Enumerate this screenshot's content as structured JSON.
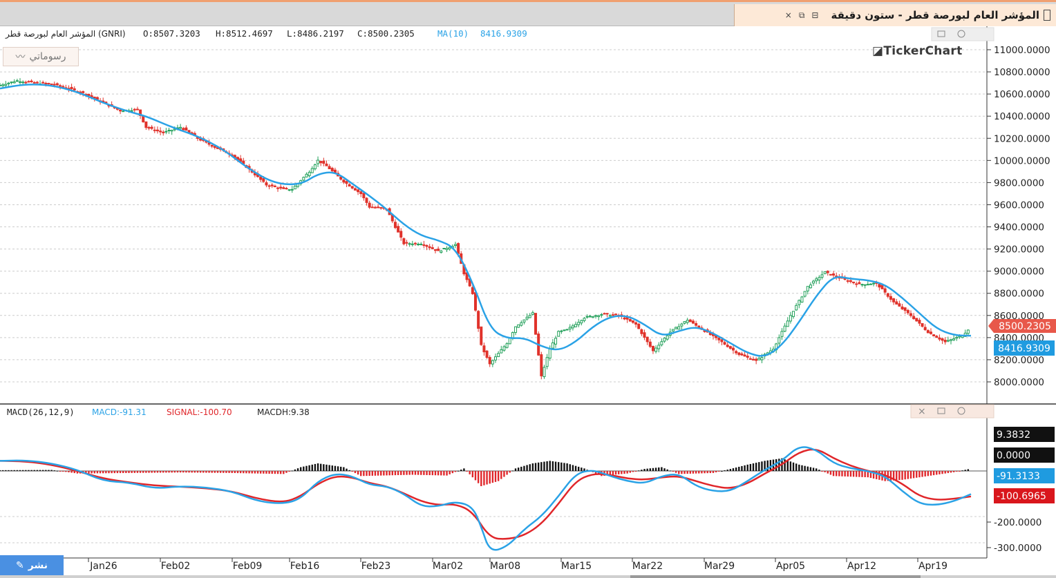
{
  "window": {
    "title": "المؤشر العام لبورصة قطر - ستون دقيقة",
    "controls": [
      "×",
      "⧉",
      "⊟"
    ]
  },
  "toolbar": {
    "drawings_label": "رسوماتي",
    "publish_label": "نشر",
    "brand": "TickerChart"
  },
  "price_panel": {
    "symbol_label": "المؤشر العام لبورصة قطر (GNRI)",
    "ohlc": {
      "open": "O:8507.3203",
      "high": "H:8512.4697",
      "low": "L:8486.2197",
      "close": "C:8500.2305"
    },
    "ma_label": "MA(10)",
    "ma_value": "8416.9309",
    "last_price_badge": "8500.2305",
    "ma_badge": "8416.9309",
    "y_ticks": [
      "11000.0000",
      "10800.0000",
      "10600.0000",
      "10400.0000",
      "10200.0000",
      "10000.0000",
      "9800.0000",
      "9600.0000",
      "9400.0000",
      "9200.0000",
      "9000.0000",
      "8800.0000",
      "8600.0000",
      "8400.0000",
      "8200.0000",
      "8000.0000"
    ]
  },
  "macd_panel": {
    "label": "MACD(26,12,9)",
    "macd": "MACD:-91.31",
    "signal": "SIGNAL:-100.70",
    "hist": "MACDH:9.38",
    "badges": {
      "hist": "9.3832",
      "zero": "0.0000",
      "macd": "-91.3133",
      "signal": "-100.6965"
    },
    "y_ticks": [
      "-200.0000",
      "-300.0000"
    ]
  },
  "x_axis": {
    "labels": [
      "Jan26",
      "Feb02",
      "Feb09",
      "Feb16",
      "Feb23",
      "Mar02",
      "Mar08",
      "Mar15",
      "Mar22",
      "Mar29",
      "Apr05",
      "Apr12",
      "Apr19"
    ]
  },
  "colors": {
    "up": "#22a05a",
    "down": "#e0322b",
    "ma": "#2aa2e6",
    "macd": "#2aa2e6",
    "signal": "#e0262a",
    "hist_pos": "#111111",
    "hist_neg": "#e0262a"
  },
  "chart_data": [
    {
      "type": "line",
      "x_index_range": [
        0,
        100
      ],
      "ylim": [
        7950,
        11050
      ],
      "series": [
        {
          "name": "المؤشر العام لبورصة قطر (GNRI)",
          "kind": "candlestick",
          "approx_close_path": [
            [
              0,
              10680
            ],
            [
              2,
              10720
            ],
            [
              4,
              10700
            ],
            [
              6,
              10690
            ],
            [
              8,
              10650
            ],
            [
              10,
              10600
            ],
            [
              12,
              10520
            ],
            [
              14,
              10450
            ],
            [
              16,
              10460
            ],
            [
              17,
              10300
            ],
            [
              19,
              10250
            ],
            [
              21,
              10300
            ],
            [
              23,
              10200
            ],
            [
              25,
              10120
            ],
            [
              27,
              10050
            ],
            [
              29,
              9920
            ],
            [
              31,
              9780
            ],
            [
              33,
              9740
            ],
            [
              34,
              9740
            ],
            [
              36,
              9900
            ],
            [
              37,
              10000
            ],
            [
              38,
              9950
            ],
            [
              40,
              9810
            ],
            [
              42,
              9700
            ],
            [
              43,
              9580
            ],
            [
              45,
              9560
            ],
            [
              46,
              9400
            ],
            [
              47,
              9250
            ],
            [
              49,
              9250
            ],
            [
              51,
              9180
            ],
            [
              53,
              9240
            ],
            [
              54,
              8980
            ],
            [
              55,
              8800
            ],
            [
              56,
              8330
            ],
            [
              57,
              8160
            ],
            [
              59,
              8350
            ],
            [
              60,
              8500
            ],
            [
              62,
              8620
            ],
            [
              63,
              8050
            ],
            [
              64,
              8300
            ],
            [
              65,
              8450
            ],
            [
              66,
              8470
            ],
            [
              68,
              8580
            ],
            [
              70,
              8610
            ],
            [
              72,
              8600
            ],
            [
              74,
              8520
            ],
            [
              76,
              8280
            ],
            [
              78,
              8450
            ],
            [
              80,
              8560
            ],
            [
              82,
              8460
            ],
            [
              84,
              8360
            ],
            [
              86,
              8250
            ],
            [
              88,
              8190
            ],
            [
              90,
              8300
            ],
            [
              92,
              8600
            ],
            [
              94,
              8860
            ],
            [
              96,
              8990
            ],
            [
              98,
              8930
            ],
            [
              100,
              8880
            ],
            [
              102,
              8890
            ],
            [
              104,
              8720
            ],
            [
              106,
              8600
            ],
            [
              108,
              8450
            ],
            [
              110,
              8360
            ],
            [
              112,
              8420
            ],
            [
              113,
              8500
            ]
          ]
        },
        {
          "name": "MA(10)",
          "values": [
            [
              0,
              10650
            ],
            [
              3,
              10690
            ],
            [
              6,
              10680
            ],
            [
              9,
              10620
            ],
            [
              12,
              10520
            ],
            [
              15,
              10440
            ],
            [
              17,
              10400
            ],
            [
              20,
              10300
            ],
            [
              23,
              10220
            ],
            [
              26,
              10100
            ],
            [
              29,
              9920
            ],
            [
              32,
              9790
            ],
            [
              35,
              9780
            ],
            [
              37,
              9880
            ],
            [
              39,
              9900
            ],
            [
              41,
              9790
            ],
            [
              43,
              9680
            ],
            [
              45,
              9560
            ],
            [
              47,
              9420
            ],
            [
              49,
              9320
            ],
            [
              51,
              9280
            ],
            [
              53,
              9210
            ],
            [
              55,
              8900
            ],
            [
              57,
              8480
            ],
            [
              59,
              8390
            ],
            [
              61,
              8400
            ],
            [
              63,
              8320
            ],
            [
              65,
              8280
            ],
            [
              67,
              8360
            ],
            [
              69,
              8500
            ],
            [
              71,
              8590
            ],
            [
              73,
              8600
            ],
            [
              75,
              8520
            ],
            [
              77,
              8410
            ],
            [
              79,
              8460
            ],
            [
              81,
              8500
            ],
            [
              83,
              8440
            ],
            [
              85,
              8350
            ],
            [
              87,
              8260
            ],
            [
              89,
              8220
            ],
            [
              91,
              8330
            ],
            [
              93,
              8540
            ],
            [
              95,
              8780
            ],
            [
              97,
              8960
            ],
            [
              99,
              8930
            ],
            [
              101,
              8920
            ],
            [
              103,
              8880
            ],
            [
              105,
              8760
            ],
            [
              107,
              8620
            ],
            [
              109,
              8480
            ],
            [
              111,
              8420
            ],
            [
              113,
              8416.93
            ]
          ]
        }
      ]
    },
    {
      "type": "line",
      "ylim": [
        -330,
        110
      ],
      "series": [
        {
          "name": "MACD",
          "values": [
            [
              0,
              40
            ],
            [
              3,
              42
            ],
            [
              6,
              30
            ],
            [
              9,
              5
            ],
            [
              12,
              -40
            ],
            [
              15,
              -45
            ],
            [
              18,
              -70
            ],
            [
              21,
              -60
            ],
            [
              24,
              -65
            ],
            [
              27,
              -80
            ],
            [
              30,
              -120
            ],
            [
              33,
              -130
            ],
            [
              35,
              -110
            ],
            [
              37,
              -40
            ],
            [
              39,
              -10
            ],
            [
              41,
              -20
            ],
            [
              43,
              -55
            ],
            [
              45,
              -60
            ],
            [
              47,
              -90
            ],
            [
              49,
              -140
            ],
            [
              51,
              -140
            ],
            [
              53,
              -120
            ],
            [
              55,
              -140
            ],
            [
              56,
              -220
            ],
            [
              57,
              -320
            ],
            [
              59,
              -300
            ],
            [
              61,
              -230
            ],
            [
              63,
              -180
            ],
            [
              65,
              -100
            ],
            [
              67,
              -10
            ],
            [
              69,
              5
            ],
            [
              71,
              -20
            ],
            [
              73,
              -40
            ],
            [
              75,
              -50
            ],
            [
              77,
              -20
            ],
            [
              79,
              -10
            ],
            [
              81,
              -60
            ],
            [
              83,
              -80
            ],
            [
              85,
              -80
            ],
            [
              87,
              -40
            ],
            [
              89,
              5
            ],
            [
              91,
              40
            ],
            [
              93,
              100
            ],
            [
              95,
              85
            ],
            [
              97,
              30
            ],
            [
              99,
              10
            ],
            [
              101,
              0
            ],
            [
              103,
              -20
            ],
            [
              105,
              -80
            ],
            [
              107,
              -130
            ],
            [
              109,
              -135
            ],
            [
              111,
              -120
            ],
            [
              113,
              -91.31
            ]
          ]
        },
        {
          "name": "SIGNAL",
          "values": [
            [
              0,
              40
            ],
            [
              3,
              38
            ],
            [
              6,
              25
            ],
            [
              9,
              0
            ],
            [
              12,
              -30
            ],
            [
              15,
              -45
            ],
            [
              18,
              -58
            ],
            [
              21,
              -62
            ],
            [
              24,
              -68
            ],
            [
              27,
              -80
            ],
            [
              30,
              -110
            ],
            [
              33,
              -125
            ],
            [
              35,
              -100
            ],
            [
              37,
              -50
            ],
            [
              39,
              -20
            ],
            [
              41,
              -25
            ],
            [
              43,
              -48
            ],
            [
              45,
              -60
            ],
            [
              47,
              -88
            ],
            [
              49,
              -120
            ],
            [
              51,
              -135
            ],
            [
              53,
              -130
            ],
            [
              55,
              -160
            ],
            [
              57,
              -265
            ],
            [
              59,
              -270
            ],
            [
              61,
              -255
            ],
            [
              63,
              -210
            ],
            [
              65,
              -130
            ],
            [
              67,
              -40
            ],
            [
              69,
              -10
            ],
            [
              71,
              -15
            ],
            [
              73,
              -30
            ],
            [
              75,
              -35
            ],
            [
              77,
              -25
            ],
            [
              79,
              -20
            ],
            [
              81,
              -40
            ],
            [
              83,
              -60
            ],
            [
              85,
              -70
            ],
            [
              87,
              -50
            ],
            [
              89,
              -10
            ],
            [
              91,
              25
            ],
            [
              93,
              75
            ],
            [
              95,
              90
            ],
            [
              97,
              50
            ],
            [
              99,
              20
            ],
            [
              101,
              0
            ],
            [
              103,
              -15
            ],
            [
              105,
              -50
            ],
            [
              107,
              -100
            ],
            [
              109,
              -115
            ],
            [
              111,
              -110
            ],
            [
              113,
              -100.7
            ]
          ]
        },
        {
          "name": "MACDH",
          "kind": "histogram",
          "approx_profile": [
            [
              0,
              3
            ],
            [
              6,
              4
            ],
            [
              9,
              -10
            ],
            [
              15,
              -8
            ],
            [
              21,
              -6
            ],
            [
              27,
              -8
            ],
            [
              33,
              -12
            ],
            [
              35,
              15
            ],
            [
              37,
              30
            ],
            [
              40,
              15
            ],
            [
              42,
              -20
            ],
            [
              48,
              -15
            ],
            [
              52,
              -18
            ],
            [
              54,
              10
            ],
            [
              56,
              -60
            ],
            [
              58,
              -40
            ],
            [
              60,
              10
            ],
            [
              62,
              30
            ],
            [
              64,
              40
            ],
            [
              66,
              30
            ],
            [
              68,
              10
            ],
            [
              70,
              -20
            ],
            [
              73,
              -10
            ],
            [
              75,
              8
            ],
            [
              77,
              15
            ],
            [
              79,
              -12
            ],
            [
              83,
              -8
            ],
            [
              85,
              8
            ],
            [
              87,
              25
            ],
            [
              89,
              40
            ],
            [
              91,
              50
            ],
            [
              93,
              25
            ],
            [
              95,
              10
            ],
            [
              97,
              -20
            ],
            [
              101,
              -25
            ],
            [
              103,
              -40
            ],
            [
              105,
              -35
            ],
            [
              108,
              -20
            ],
            [
              111,
              -5
            ],
            [
              113,
              9.38
            ]
          ]
        }
      ]
    }
  ]
}
